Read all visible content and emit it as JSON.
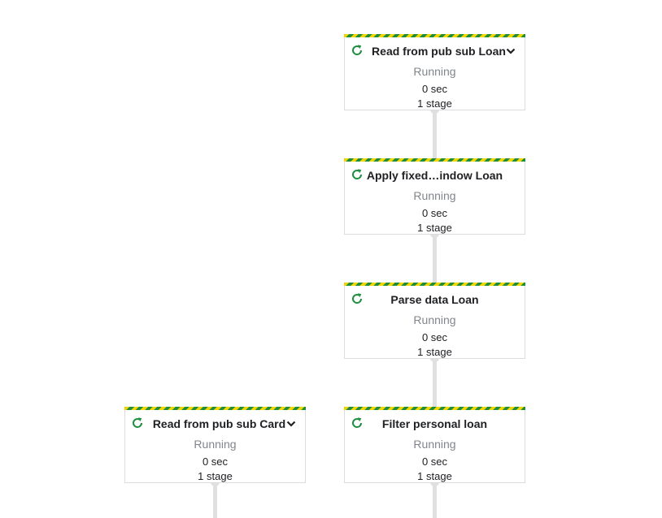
{
  "colors": {
    "running_icon": "#1e8e3e",
    "stripe_green": "#1e8e3e",
    "stripe_yellow": "#f2d600",
    "edge": "#e0e0e0",
    "status_text": "#80868b"
  },
  "nodes": [
    {
      "title": "Read from pub sub Loan",
      "status": "Running",
      "time": "0 sec",
      "stages": "1 stage",
      "icon": "running-refresh-icon",
      "has_chevron": true
    },
    {
      "title": "Apply fixed…indow Loan",
      "status": "Running",
      "time": "0 sec",
      "stages": "1 stage",
      "icon": "running-refresh-icon",
      "has_chevron": false
    },
    {
      "title": "Parse data Loan",
      "status": "Running",
      "time": "0 sec",
      "stages": "1 stage",
      "icon": "running-refresh-icon",
      "has_chevron": false
    },
    {
      "title": "Read from pub sub Card",
      "status": "Running",
      "time": "0 sec",
      "stages": "1 stage",
      "icon": "running-refresh-icon",
      "has_chevron": true
    },
    {
      "title": "Filter personal loan",
      "status": "Running",
      "time": "0 sec",
      "stages": "1 stage",
      "icon": "running-refresh-icon",
      "has_chevron": false
    }
  ]
}
